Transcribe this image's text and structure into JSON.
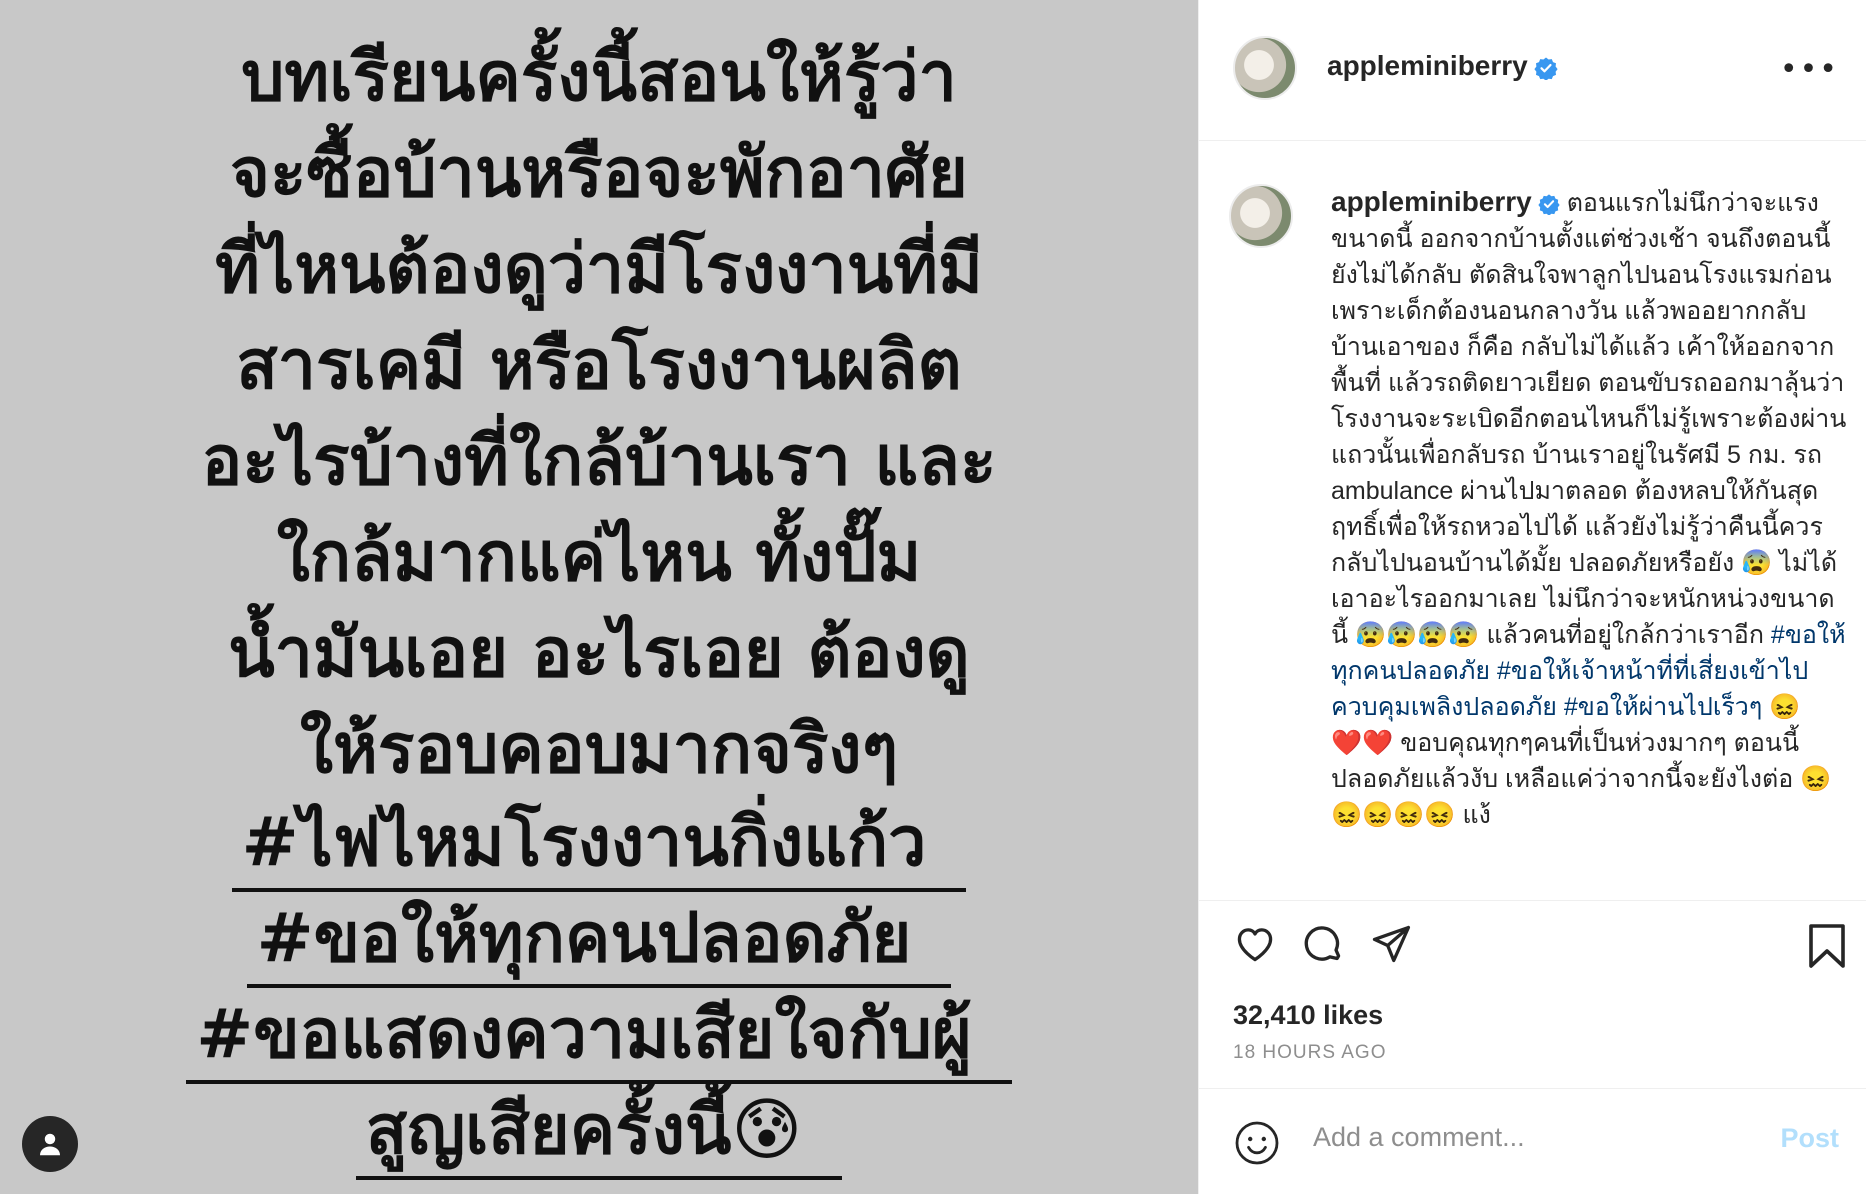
{
  "image_text": {
    "lines": [
      "บทเรียนครั้งนี้สอนให้รู้ว่า",
      "จะซื้อบ้านหรือจะพักอาศัย",
      "ที่ไหนต้องดูว่ามีโรงงานที่มี",
      "สารเคมี หรือโรงงานผลิต",
      "อะไรบ้างที่ใกล้บ้านเรา และ",
      "ใกล้มากแค่ไหน ทั้งปั๊ม",
      "น้ำมันเอย อะไรเอย ต้องดู",
      "ให้รอบคอบมากจริงๆ"
    ],
    "hashtags": [
      "#ไฟไหมโรงงานกิ่งแก้ว",
      "#ขอให้ทุกคนปลอดภัย",
      "#ขอแสดงความเสียใจกับผู้",
      "สูญเสียครั้งนี้😰"
    ]
  },
  "header": {
    "username": "appleminiberry",
    "more_icon": "more-horizontal-icon"
  },
  "caption": {
    "username": "appleminiberry",
    "text_1": "ตอนแรกไม่นึกว่าจะแรงขนาดนี้ ออกจากบ้านตั้งแต่ช่วงเช้า จนถึงตอนนี้ยังไม่ได้กลับ ตัดสินใจพาลูกไปนอนโรงแรมก่อนเพราะเด็กต้องนอนกลางวัน แล้วพออยากกลับบ้านเอาของ ก็คือ กลับไม่ได้แล้ว เค้าให้ออกจากพื้นที่ แล้วรถติดยาวเยียด ตอนขับรถออกมาลุ้นว่าโรงงานจะระเบิดอีกตอนไหนก็ไม่รู้เพราะต้องผ่านแถวนั้นเพื่อกลับรถ บ้านเราอยู่ในรัศมี 5 กม. รถ ambulance ผ่านไปมาตลอด ต้องหลบให้กันสุดฤทธิ์เพื่อให้รถหวอไปได้ แล้วยังไม่รู้ว่าคืนนี้ควรกลับไปนอนบ้านได้มั้ย ปลอดภัยหรือยัง 😰 ไม่ได้เอาอะไรออกมาเลย ไม่นึกว่าจะหนักหน่วงขนาดนี้ 😰😰😰😰 แล้วคนที่อยู่ใกล้กว่าเราอีก",
    "tag_1": "#ขอให้ทุกคนปลอดภัย",
    "tag_2": "#ขอให้เจ้าหน้าที่ที่เสี่ยงเข้าไปควบคุมเพลิงปลอดภัย",
    "tag_3": "#ขอให้ผ่านไปเร็วๆ",
    "text_2": "😖",
    "text_3": "❤️❤️ ขอบคุณทุกๆคนที่เป็นห่วงมากๆ ตอนนี้ปลอดภัยแล้วงับ เหลือแค่ว่าจากนี้จะยังไงต่อ 😖😖😖😖😖 แง้"
  },
  "actions": {
    "icons": [
      "heart-icon",
      "comment-icon",
      "share-icon",
      "bookmark-icon"
    ],
    "likes": "32,410 likes",
    "time": "18 HOURS AGO"
  },
  "comment": {
    "placeholder": "Add a comment...",
    "post_label": "Post"
  },
  "colors": {
    "image_bg": "#c8c8c8",
    "hashtag": "#00376b",
    "verified": "#3897f0",
    "post_disabled": "#b2dffc"
  }
}
